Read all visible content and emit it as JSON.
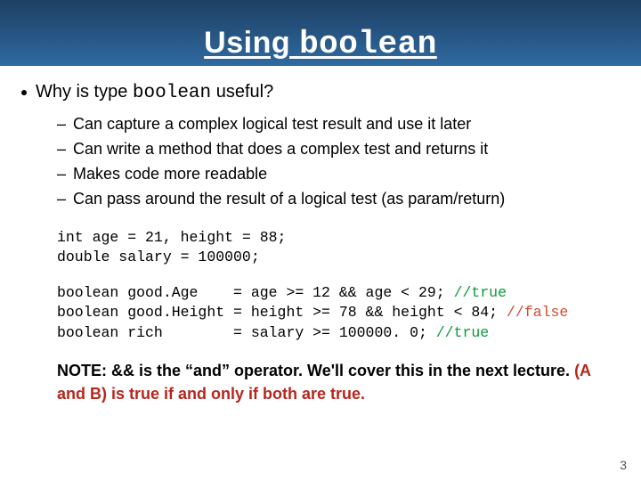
{
  "title": {
    "prefix": "Using ",
    "mono": "boolean"
  },
  "bullet": {
    "before": "Why is type ",
    "mono": "boolean",
    "after": " useful?"
  },
  "sub": [
    "Can capture a complex logical test result and use it later",
    "Can write a method that does a complex test and returns it",
    "Makes code more readable",
    "Can pass around the result of a logical test (as param/return)"
  ],
  "code": {
    "block1": [
      "int age = 21, height = 88;",
      "double salary = 100000;"
    ],
    "block2": [
      {
        "pre": "boolean good.Age    = age >= 12 && age < 29; ",
        "comment": "//true",
        "cls": "c-true"
      },
      {
        "pre": "boolean good.Height = height >= 78 && height < 84; ",
        "comment": "//false",
        "cls": "c-false"
      },
      {
        "pre": "boolean rich        = salary >= 100000. 0; ",
        "comment": "//true",
        "cls": "c-true"
      }
    ]
  },
  "note": {
    "p1": "NOTE: && is the “and” operator. We'll cover this in the next lecture. ",
    "p2": "(A and B) is true if and only if both are true."
  },
  "page": "3"
}
